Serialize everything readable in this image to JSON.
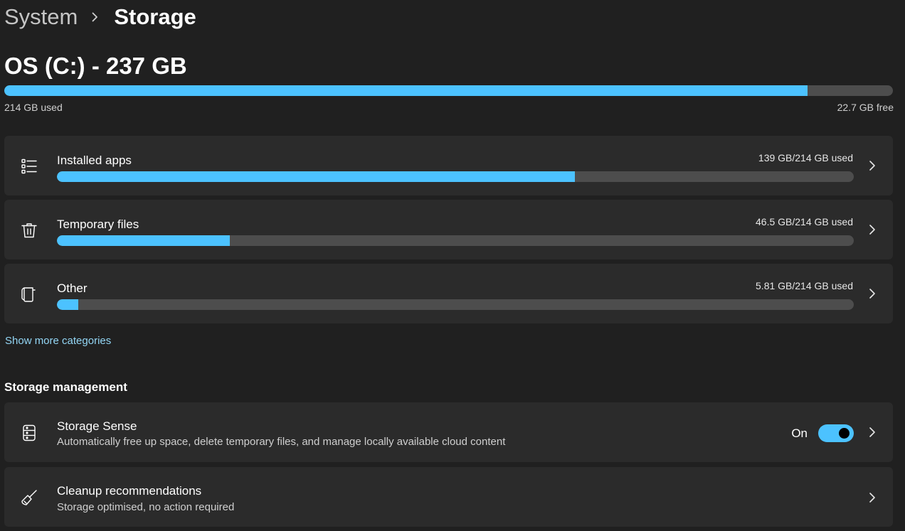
{
  "breadcrumb": {
    "parent": "System",
    "current": "Storage"
  },
  "drive": {
    "title": "OS (C:) - 237 GB",
    "used_label": "214 GB used",
    "free_label": "22.7 GB free",
    "used_fraction": 0.904
  },
  "categories": [
    {
      "label": "Installed apps",
      "usage": "139 GB/214 GB used",
      "fraction": 0.65,
      "icon": "list-icon"
    },
    {
      "label": "Temporary files",
      "usage": "46.5 GB/214 GB used",
      "fraction": 0.217,
      "icon": "trash-icon"
    },
    {
      "label": "Other",
      "usage": "5.81 GB/214 GB used",
      "fraction": 0.027,
      "icon": "document-icon"
    }
  ],
  "show_more": "Show more categories",
  "management": {
    "title": "Storage management",
    "storage_sense": {
      "title": "Storage Sense",
      "description": "Automatically free up space, delete temporary files, and manage locally available cloud content",
      "state_label": "On",
      "enabled": true
    },
    "cleanup": {
      "title": "Cleanup recommendations",
      "description": "Storage optimised, no action required"
    }
  },
  "colors": {
    "accent": "#4cc2ff",
    "background": "#202020",
    "card": "#2b2b2b",
    "track": "#4d4d4d",
    "link": "#93d6f5"
  }
}
